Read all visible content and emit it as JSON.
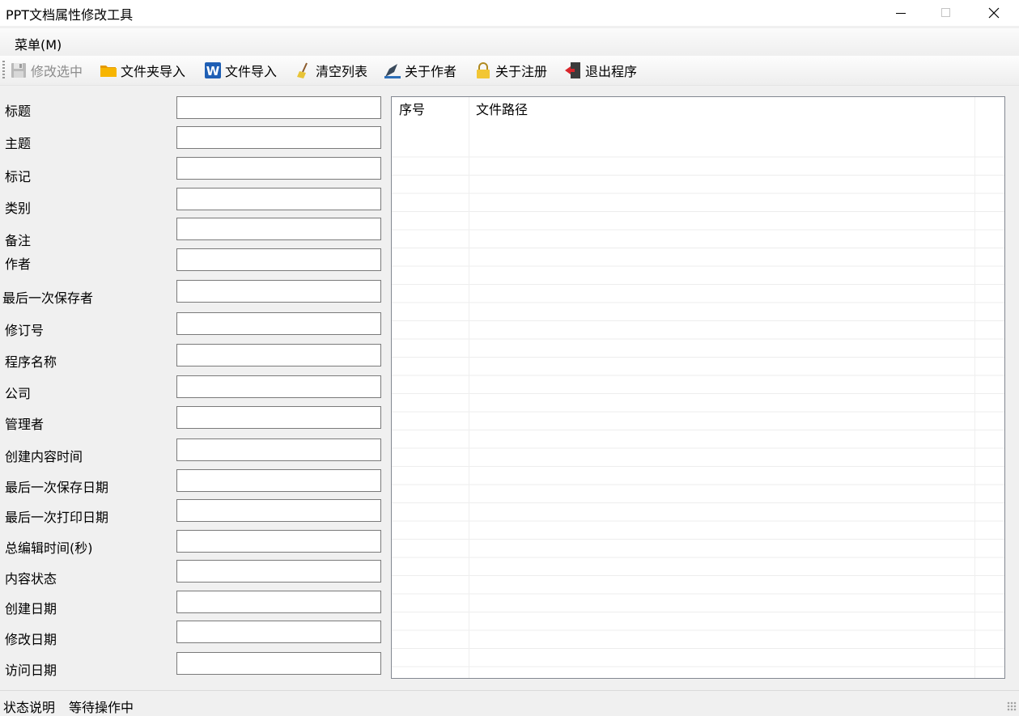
{
  "window": {
    "title": "PPT文档属性修改工具"
  },
  "menu": {
    "items": [
      {
        "label": "菜单(M)"
      }
    ]
  },
  "toolbar": {
    "buttons": [
      {
        "label": "修改选中",
        "icon": "save-icon",
        "enabled": false
      },
      {
        "label": "文件夹导入",
        "icon": "folder-icon"
      },
      {
        "label": "文件导入",
        "icon": "word-file-icon"
      },
      {
        "label": "清空列表",
        "icon": "broom-icon"
      },
      {
        "label": "关于作者",
        "icon": "author-pen-icon"
      },
      {
        "label": "关于注册",
        "icon": "lock-icon"
      },
      {
        "label": "退出程序",
        "icon": "exit-door-icon"
      }
    ]
  },
  "form": {
    "fields": [
      {
        "label": "标题",
        "value": ""
      },
      {
        "label": "主题",
        "value": ""
      },
      {
        "label": "标记",
        "value": ""
      },
      {
        "label": "类别",
        "value": ""
      },
      {
        "label": "备注",
        "value": ""
      },
      {
        "label": "作者",
        "value": ""
      },
      {
        "label": "最后一次保存者",
        "value": ""
      },
      {
        "label": "修订号",
        "value": ""
      },
      {
        "label": "程序名称",
        "value": ""
      },
      {
        "label": "公司",
        "value": ""
      },
      {
        "label": "管理者",
        "value": ""
      },
      {
        "label": "创建内容时间",
        "value": ""
      },
      {
        "label": "最后一次保存日期",
        "value": ""
      },
      {
        "label": "最后一次打印日期",
        "value": ""
      },
      {
        "label": "总编辑时间(秒)",
        "value": ""
      },
      {
        "label": "内容状态",
        "value": ""
      },
      {
        "label": "创建日期",
        "value": ""
      },
      {
        "label": "修改日期",
        "value": ""
      },
      {
        "label": "访问日期",
        "value": ""
      }
    ]
  },
  "list": {
    "columns": [
      {
        "label": "序号"
      },
      {
        "label": "文件路径"
      }
    ],
    "rows": []
  },
  "status": {
    "label": "状态说明",
    "text": "等待操作中"
  },
  "colors": {
    "window_bg": "#f0f0f0",
    "disabled_text": "#8c8c8c",
    "input_border": "#7a7a7a"
  }
}
